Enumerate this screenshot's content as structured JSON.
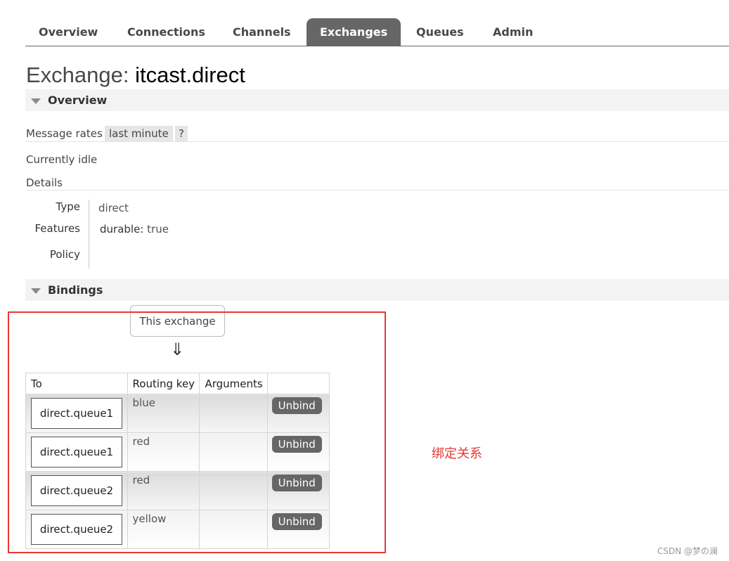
{
  "tabs": [
    {
      "label": "Overview",
      "active": false
    },
    {
      "label": "Connections",
      "active": false
    },
    {
      "label": "Channels",
      "active": false
    },
    {
      "label": "Exchanges",
      "active": true
    },
    {
      "label": "Queues",
      "active": false
    },
    {
      "label": "Admin",
      "active": false
    }
  ],
  "page": {
    "title_prefix": "Exchange:",
    "exchange_name": "itcast.direct"
  },
  "overview": {
    "heading": "Overview",
    "message_rates_label": "Message rates",
    "rates_range": "last minute",
    "help_label": "?",
    "status": "Currently idle",
    "details_label": "Details",
    "details": {
      "type_key": "Type",
      "type_value": "direct",
      "features_key": "Features",
      "feature_name": "durable:",
      "feature_value": "true",
      "policy_key": "Policy",
      "policy_value": ""
    }
  },
  "bindings": {
    "heading": "Bindings",
    "source_label": "This exchange",
    "arrow": "⇓",
    "columns": [
      "To",
      "Routing key",
      "Arguments",
      ""
    ],
    "rows": [
      {
        "to": "direct.queue1",
        "routing_key": "blue",
        "arguments": "",
        "action": "Unbind"
      },
      {
        "to": "direct.queue1",
        "routing_key": "red",
        "arguments": "",
        "action": "Unbind"
      },
      {
        "to": "direct.queue2",
        "routing_key": "red",
        "arguments": "",
        "action": "Unbind"
      },
      {
        "to": "direct.queue2",
        "routing_key": "yellow",
        "arguments": "",
        "action": "Unbind"
      }
    ]
  },
  "annotation": {
    "text": "绑定关系",
    "color": "#e53935"
  },
  "watermark": "CSDN @梦の澜",
  "colors": {
    "active_tab": "#666666",
    "button": "#666666",
    "highlight": "#e53935"
  }
}
